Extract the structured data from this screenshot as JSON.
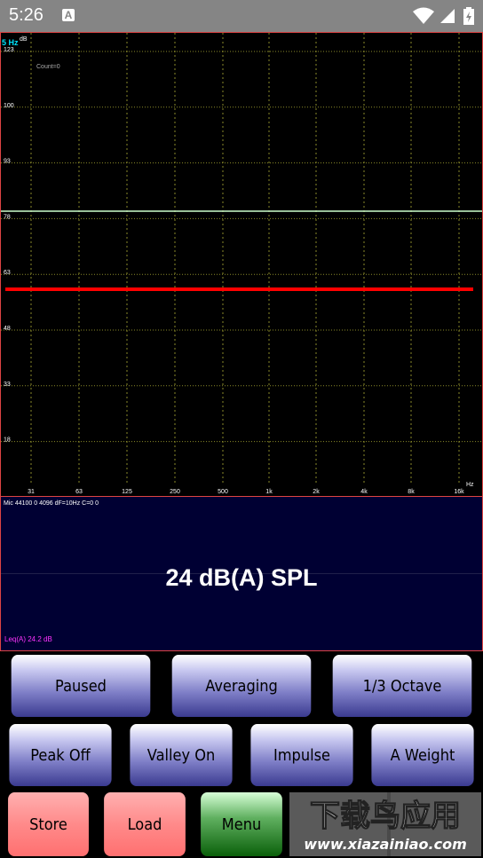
{
  "status": {
    "time": "5:26",
    "notif_icon": "A"
  },
  "graph": {
    "peak_label": "5 Hz",
    "db_unit": "dB",
    "count_label": "Count=0",
    "y_ticks": [
      "123",
      "100",
      "93",
      "78",
      "63",
      "48",
      "33",
      "18"
    ],
    "x_ticks": [
      "31",
      "63",
      "125",
      "250",
      "500",
      "1k",
      "2k",
      "4k",
      "8k",
      "16k"
    ],
    "x_unit": "Hz"
  },
  "info": {
    "params": "Mic 44100 0 4096 dF=10Hz C=0 0",
    "reading": "24 dB(A) SPL",
    "leq": "Leq(A) 24.2 dB"
  },
  "buttons": {
    "paused": "Paused",
    "averaging": "Averaging",
    "octave": "1/3 Octave",
    "peak": "Peak Off",
    "valley": "Valley On",
    "impulse": "Impulse",
    "weight": "A Weight",
    "store": "Store",
    "load": "Load",
    "menu": "Menu"
  },
  "watermark": {
    "text_cn": "下载吧应用",
    "url": "www.xiazainiao.com"
  },
  "chart_data": {
    "type": "line",
    "y_ticks": [
      123,
      100,
      93,
      78,
      63,
      48,
      33,
      18
    ],
    "x_ticks": [
      "31",
      "63",
      "125",
      "250",
      "500",
      "1k",
      "2k",
      "4k",
      "8k",
      "16k"
    ],
    "series": [
      {
        "color": "#ccffcc",
        "values": [
          80
        ]
      },
      {
        "color": "#ff0000",
        "values": [
          59
        ]
      }
    ],
    "grid": true
  }
}
